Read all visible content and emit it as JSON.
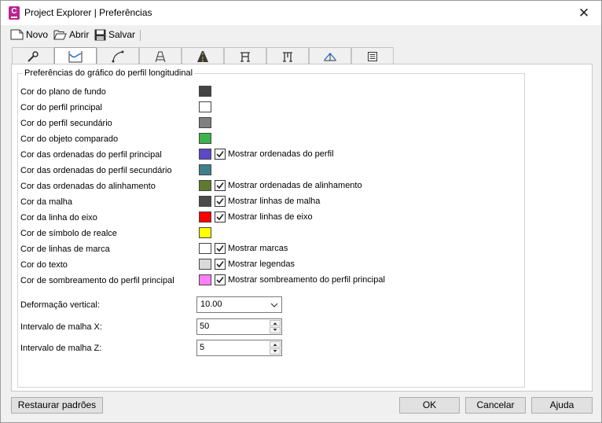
{
  "window": {
    "title": "Project Explorer | Preferências",
    "app_icon_letter": "C",
    "close_glyph": "✕"
  },
  "toolbar": {
    "new_label": "Novo",
    "open_label": "Abrir",
    "save_label": "Salvar"
  },
  "tabs": [
    {
      "icon": "wrench-icon",
      "active": false
    },
    {
      "icon": "profile-view-icon",
      "active": true
    },
    {
      "icon": "alignment-curve-icon",
      "active": false
    },
    {
      "icon": "corridor-icon",
      "active": false
    },
    {
      "icon": "road-icon",
      "active": false
    },
    {
      "icon": "structure-icon",
      "active": false
    },
    {
      "icon": "structure-alt-icon",
      "active": false
    },
    {
      "icon": "surface-icon",
      "active": false
    },
    {
      "icon": "list-icon",
      "active": false
    }
  ],
  "group": {
    "title": "Preferências do gráfico do perfil longitudinal"
  },
  "color_rows": [
    {
      "label": "Cor do plano de fundo",
      "color": "#444444",
      "checkbox": null
    },
    {
      "label": "Cor do perfil principal",
      "color": "#ffffff",
      "checkbox": null
    },
    {
      "label": "Cor do perfil secundário",
      "color": "#808080",
      "checkbox": null
    },
    {
      "label": "Cor do objeto comparado",
      "color": "#3cb44b",
      "checkbox": null
    },
    {
      "label": "Cor das ordenadas do perfil principal",
      "color": "#5b49c9",
      "checkbox": {
        "label": "Mostrar ordenadas do perfil",
        "checked": true
      }
    },
    {
      "label": "Cor das ordenadas do perfil secundário",
      "color": "#3f7f8a",
      "checkbox": null
    },
    {
      "label": "Cor das ordenadas do alinhamento",
      "color": "#5f7a2e",
      "checkbox": {
        "label": "Mostrar ordenadas de alinhamento",
        "checked": true
      }
    },
    {
      "label": "Cor da malha",
      "color": "#4a4a4a",
      "checkbox": {
        "label": "Mostrar linhas de malha",
        "checked": true
      }
    },
    {
      "label": "Cor da linha do eixo",
      "color": "#ff0000",
      "checkbox": {
        "label": "Mostrar linhas de eixo",
        "checked": true
      }
    },
    {
      "label": "Cor de símbolo de realce",
      "color": "#ffff00",
      "checkbox": null
    },
    {
      "label": "Cor de linhas de marca",
      "color": "#ffffff",
      "checkbox": {
        "label": "Mostrar marcas",
        "checked": true
      }
    },
    {
      "label": "Cor do texto",
      "color": "#d9d9d9",
      "checkbox": {
        "label": "Mostrar legendas",
        "checked": true
      }
    },
    {
      "label": "Cor de sombreamento do perfil principal",
      "color": "#ff80ff",
      "checkbox": {
        "label": "Mostrar sombreamento do perfil principal",
        "checked": true
      }
    }
  ],
  "fields": {
    "vertical_exaggeration": {
      "label": "Deformação vertical:",
      "value": "10.00"
    },
    "grid_x": {
      "label": "Intervalo de malha X:",
      "value": "50"
    },
    "grid_z": {
      "label": "Intervalo de malha Z:",
      "value": "5"
    }
  },
  "buttons": {
    "restore": "Restaurar padrões",
    "ok": "OK",
    "cancel": "Cancelar",
    "help": "Ajuda"
  }
}
